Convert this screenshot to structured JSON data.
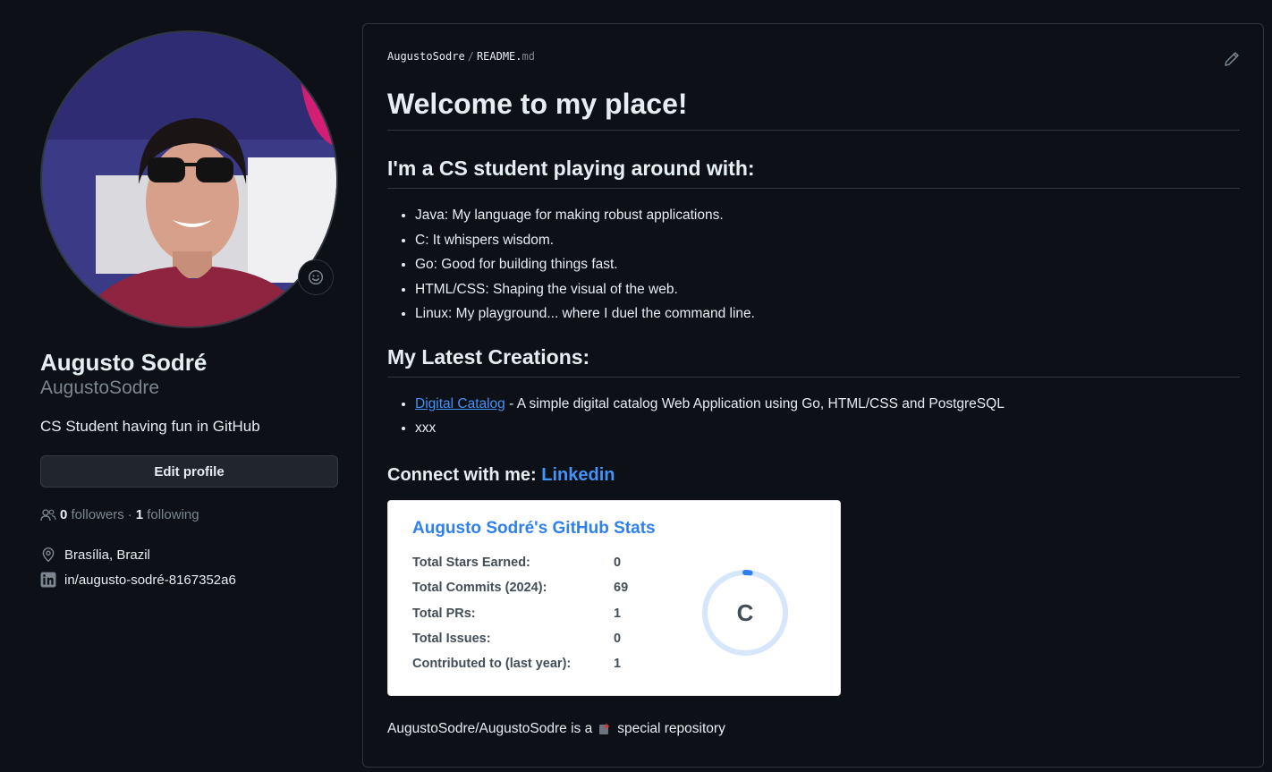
{
  "profile": {
    "name": "Augusto Sodré",
    "login": "AugustoSodre",
    "bio": "CS Student having fun in GitHub",
    "edit_label": "Edit profile",
    "followers_count": "0",
    "followers_label": "followers",
    "separator": "·",
    "following_count": "1",
    "following_label": "following",
    "location": "Brasília, Brazil",
    "linkedin": "in/augusto-sodré-8167352a6"
  },
  "readme": {
    "owner": "AugustoSodre",
    "sep": "/",
    "file_base": "README.",
    "file_ext": "md",
    "h1": "Welcome to my place!",
    "h2_playing": "I'm a CS student playing around with:",
    "skills": [
      "Java: My language for making robust applications.",
      "C: It whispers wisdom.",
      "Go: Good for building things fast.",
      "HTML/CSS: Shaping the visual of the web.",
      "Linux: My playground... where I duel the command line."
    ],
    "h2_creations": "My Latest Creations:",
    "creation_link": "Digital Catalog",
    "creation_desc": " - A simple digital catalog Web Application using Go, HTML/CSS and PostgreSQL",
    "creation_2": "xxx",
    "connect_label": "Connect with me: ",
    "connect_link": "Linkedin",
    "special_prefix": "AugustoSodre/AugustoSodre is a",
    "special_suffix": "special repository"
  },
  "stats": {
    "title": "Augusto Sodré's GitHub Stats",
    "rows": [
      {
        "label": "Total Stars Earned:",
        "value": "0"
      },
      {
        "label": "Total Commits (2024):",
        "value": "69"
      },
      {
        "label": "Total PRs:",
        "value": "1"
      },
      {
        "label": "Total Issues:",
        "value": "0"
      },
      {
        "label": "Contributed to (last year):",
        "value": "1"
      }
    ],
    "rank": "C",
    "rank_progress": 0.02
  },
  "colors": {
    "bg": "#0d1117",
    "accent": "#4493f8",
    "muted": "#7d8590",
    "card_title": "#2f80ed"
  }
}
